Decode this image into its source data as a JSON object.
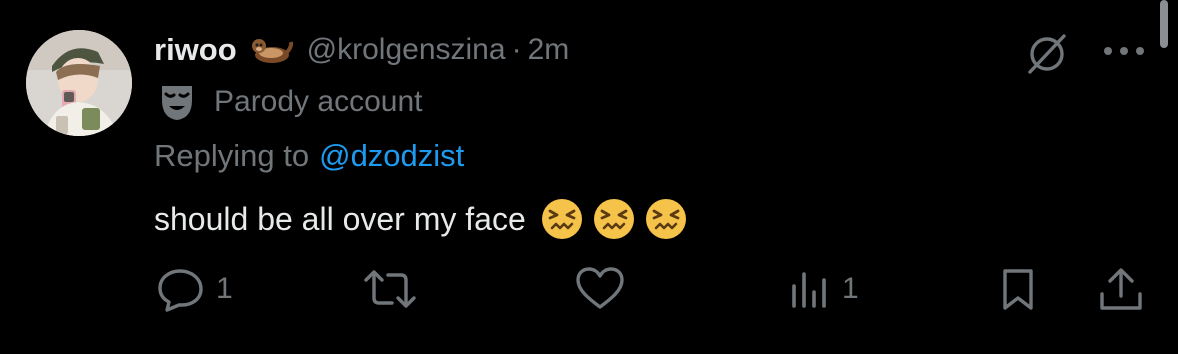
{
  "tweet": {
    "display_name": "riwoo",
    "name_emoji": "otter-emoji",
    "handle": "@krolgenszina",
    "separator": "·",
    "time": "2m",
    "parody_icon": "theater-mask-icon",
    "parody_label": "Parody account",
    "replying_label": "Replying to",
    "replying_to": "@dzodzist",
    "text": "should be all over my face",
    "emojis": [
      "confounded-face-emoji",
      "confounded-face-emoji",
      "confounded-face-emoji"
    ]
  },
  "actions": {
    "reply_count": "1",
    "retweet_count": "",
    "like_count": "",
    "views_count": "1"
  },
  "icons": {
    "top_right_1": "grok-icon",
    "top_right_2": "more-icon"
  },
  "colors": {
    "background": "#000000",
    "primary_text": "#e7e9ea",
    "secondary_text": "#71767b",
    "link": "#1d9bf0"
  }
}
